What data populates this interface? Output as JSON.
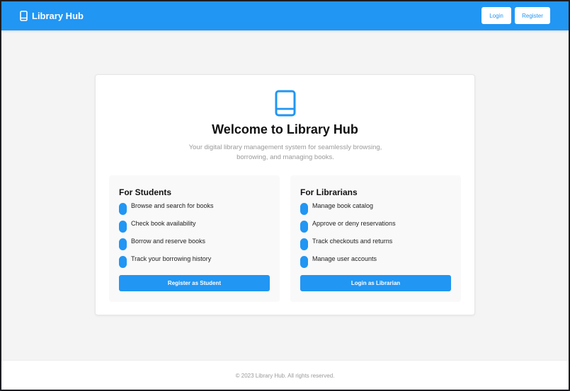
{
  "colors": {
    "accent": "#2196f3",
    "background": "#f4f4f4",
    "card": "#ffffff",
    "panel": "#f9f9f9"
  },
  "header": {
    "brand": "Library Hub",
    "brand_icon": "book-icon",
    "login_label": "Login",
    "register_label": "Register"
  },
  "main": {
    "icon": "book-icon",
    "title": "Welcome to Library Hub",
    "subtitle": "Your digital library management system for seamlessly browsing, borrowing, and managing books.",
    "students": {
      "title": "For Students",
      "items": [
        "Browse and search for books",
        "Check book availability",
        "Borrow and reserve books",
        "Track your borrowing history"
      ],
      "button": "Register as Student"
    },
    "librarians": {
      "title": "For Librarians",
      "items": [
        "Manage book catalog",
        "Approve or deny reservations",
        "Track checkouts and returns",
        "Manage user accounts"
      ],
      "button": "Login as Librarian"
    }
  },
  "footer": {
    "text": "© 2023 Library Hub. All rights reserved."
  }
}
